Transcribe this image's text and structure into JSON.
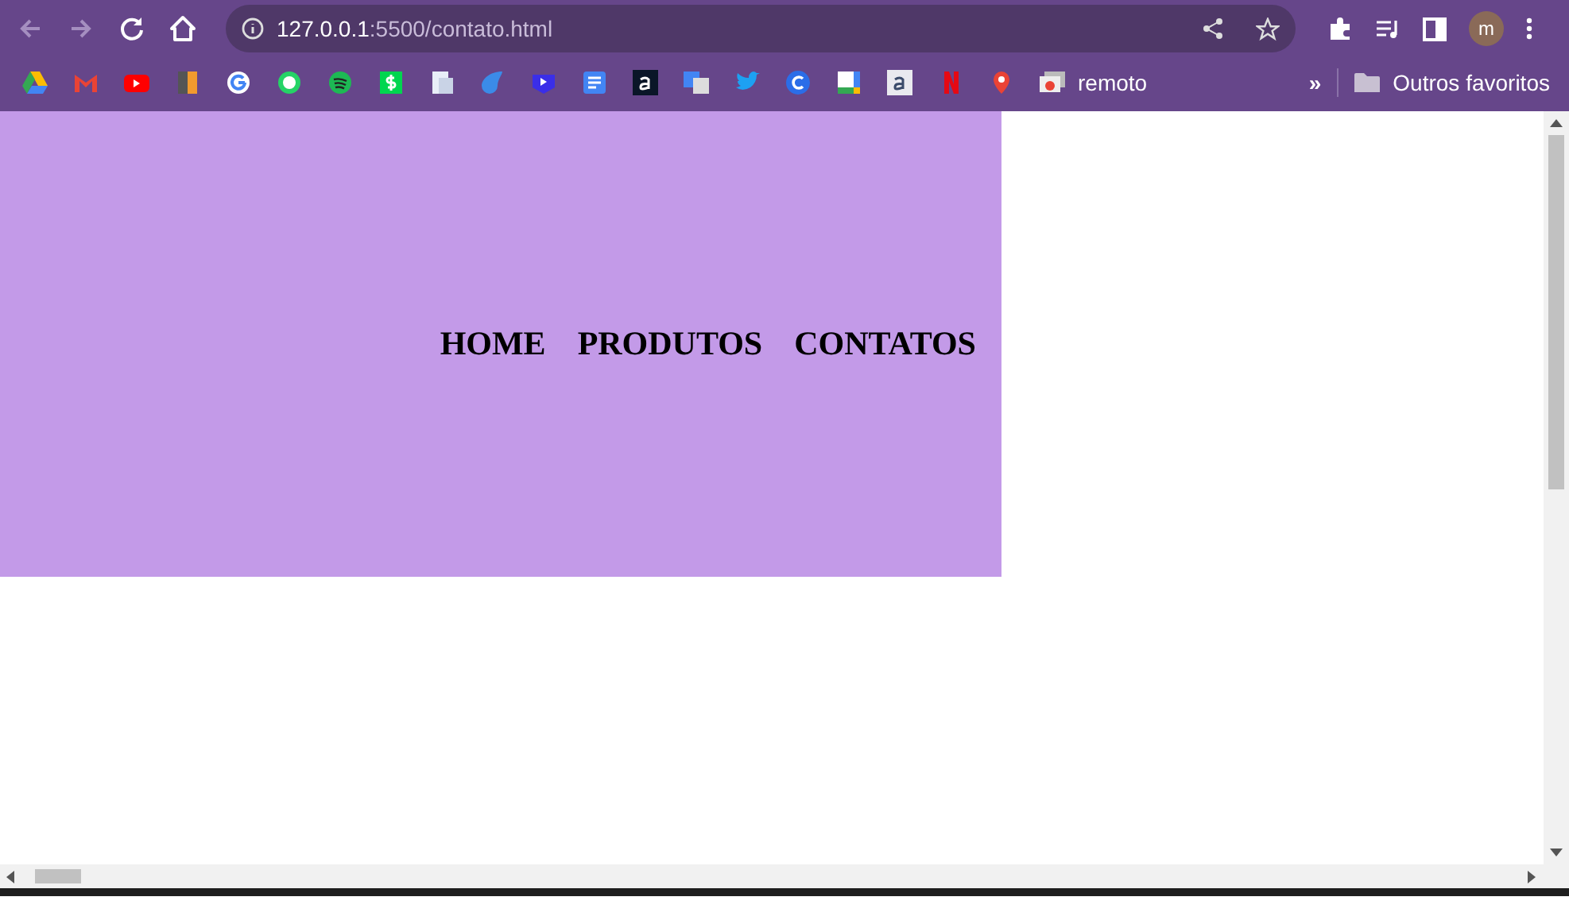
{
  "browser": {
    "address": {
      "host": "127.0.0.1",
      "rest": ":5500/contato.html"
    },
    "avatar": "m",
    "bookmarks": [
      {
        "label": "remoto"
      }
    ],
    "more": "»",
    "other_bookmarks": "Outros favoritos"
  },
  "header": {
    "nav": [
      {
        "label": "HOME"
      },
      {
        "label": "PRODUTOS"
      },
      {
        "label": "CONTATOS"
      }
    ]
  }
}
